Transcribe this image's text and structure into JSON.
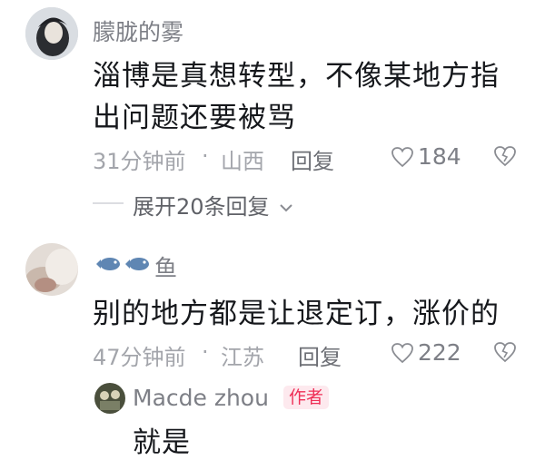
{
  "comments": [
    {
      "username": "朦胧的雾",
      "text_line1": "淄博是真想转型，不像某地方指",
      "text_line2": "出问题还要被骂",
      "time": "31分钟前",
      "separator": "·",
      "location": "山西",
      "reply_label": "回复",
      "likes": "184",
      "expand_label": "展开20条回复"
    },
    {
      "username": "鱼",
      "text": "别的地方都是让退定订，涨价的",
      "time": "47分钟前",
      "separator": "·",
      "location": "江苏",
      "reply_label": "回复",
      "likes": "222"
    }
  ],
  "reply": {
    "username": "Macde zhou",
    "badge": "作者",
    "text": "就是"
  },
  "icons": {
    "like": "heart-outline-icon",
    "dislike": "broken-heart-icon",
    "expand": "chevron-down-icon",
    "name_emoji": "fish-icon"
  },
  "colors": {
    "author_badge_bg": "#fde9ee",
    "author_badge_text": "#ef2f57"
  }
}
